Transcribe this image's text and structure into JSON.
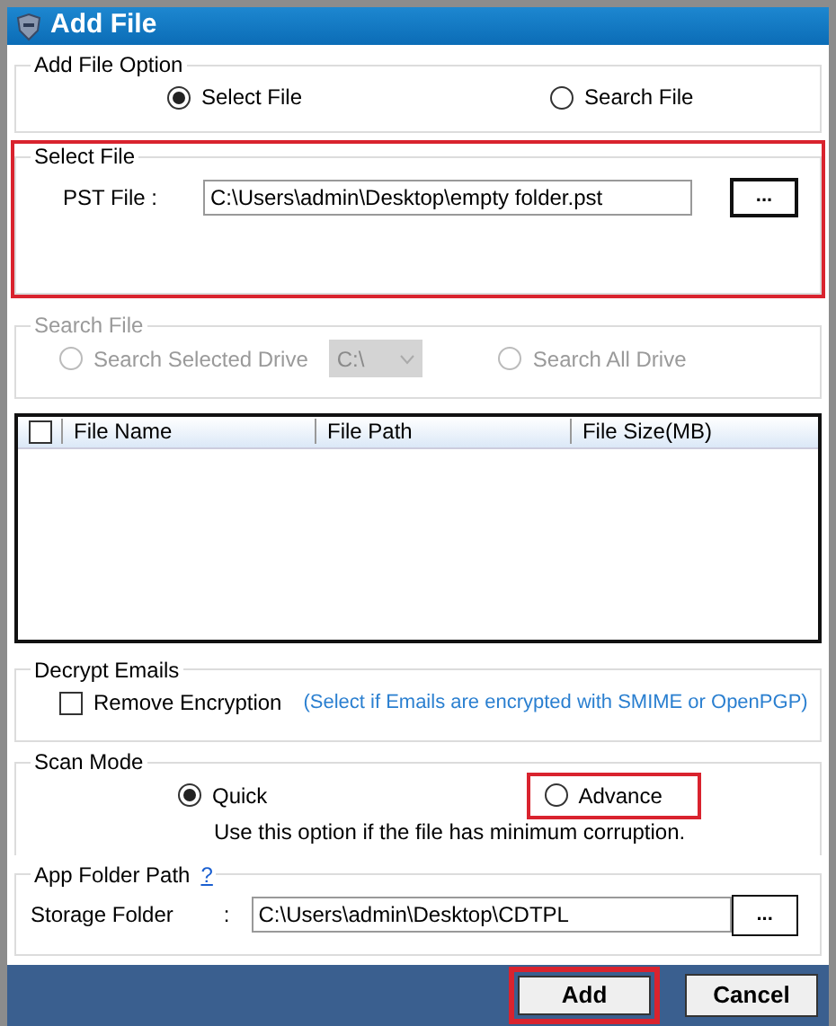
{
  "window": {
    "title": "Add File"
  },
  "add_file_option": {
    "title": "Add File Option",
    "options": [
      {
        "label": "Select File",
        "selected": true
      },
      {
        "label": "Search File",
        "selected": false
      }
    ]
  },
  "select_file": {
    "title": "Select File",
    "highlighted": true,
    "label": "PST File :",
    "value": "C:\\Users\\admin\\Desktop\\empty folder.pst",
    "browse": "..."
  },
  "search_file": {
    "title": "Search File",
    "disabled": true,
    "options": [
      {
        "label": "Search Selected Drive",
        "selected": false
      },
      {
        "label": "Search All Drive",
        "selected": false
      }
    ],
    "drive": "C:\\"
  },
  "table": {
    "select_all_checked": false,
    "columns": [
      "File Name",
      "File Path",
      "File Size(MB)"
    ]
  },
  "decrypt": {
    "title": "Decrypt Emails",
    "checkbox": {
      "label": "Remove Encryption",
      "checked": false
    },
    "hint": "(Select if Emails are encrypted with SMIME or OpenPGP)"
  },
  "scan_mode": {
    "title": "Scan Mode",
    "options": [
      {
        "label": "Quick",
        "selected": true,
        "highlighted": false
      },
      {
        "label": "Advance",
        "selected": false,
        "highlighted": true
      }
    ],
    "description": "Use this option if the file has minimum corruption."
  },
  "app_folder": {
    "title": "App Folder Path",
    "help": "?",
    "label": "Storage Folder",
    "separator": ":",
    "value": "C:\\Users\\admin\\Desktop\\CDTPL",
    "browse": "..."
  },
  "buttons": [
    {
      "label": "Add",
      "highlighted": true
    },
    {
      "label": "Cancel",
      "highlighted": false
    }
  ]
}
